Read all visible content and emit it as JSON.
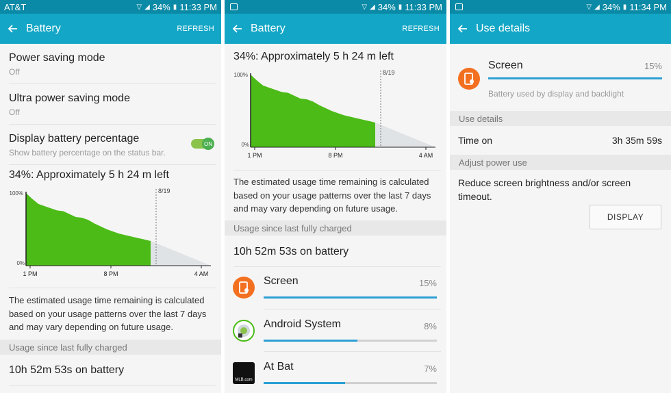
{
  "panels": [
    {
      "status": {
        "carrier": "AT&T",
        "battery": "34%",
        "time": "11:33 PM"
      },
      "appbar": {
        "title": "Battery",
        "action": "REFRESH"
      },
      "settings": [
        {
          "title": "Power saving mode",
          "sub": "Off"
        },
        {
          "title": "Ultra power saving mode",
          "sub": "Off"
        },
        {
          "title": "Display battery percentage",
          "sub": "Show battery percentage on the status bar.",
          "toggle": "ON"
        }
      ],
      "estimate": "34%: Approximately 5 h 24 m left",
      "description": "The estimated usage time remaining is calculated based on your usage patterns over the last 7 days and may vary depending on future usage.",
      "section_header": "Usage since last fully charged",
      "on_battery": "10h 52m 53s on battery"
    },
    {
      "status": {
        "battery": "34%",
        "time": "11:33 PM"
      },
      "appbar": {
        "title": "Battery",
        "action": "REFRESH"
      },
      "estimate": "34%: Approximately 5 h 24 m left",
      "description": "The estimated usage time remaining is calculated based on your usage patterns over the last 7 days and may vary depending on future usage.",
      "section_header": "Usage since last fully charged",
      "on_battery": "10h 52m 53s on battery",
      "apps": [
        {
          "name": "Screen",
          "percent": "15%",
          "fraction": 1.0,
          "icon": "screen-icon"
        },
        {
          "name": "Android System",
          "percent": "8%",
          "fraction": 0.54,
          "icon": "android-system-icon"
        },
        {
          "name": "At Bat",
          "percent": "7%",
          "fraction": 0.47,
          "icon": "at-bat-icon",
          "icon_text": "MLB.com"
        }
      ]
    },
    {
      "status": {
        "battery": "34%",
        "time": "11:34 PM"
      },
      "appbar": {
        "title": "Use details"
      },
      "app": {
        "name": "Screen",
        "percent": "15%",
        "desc": "Battery used by display and backlight"
      },
      "use_details_header": "Use details",
      "time_on_label": "Time on",
      "time_on_value": "3h 35m 59s",
      "adjust_header": "Adjust power use",
      "adjust_text": "Reduce screen brightness and/or screen timeout.",
      "display_button": "DISPLAY"
    }
  ],
  "chart_data": {
    "type": "area",
    "x_tick_labels": [
      "1 PM",
      "8 PM",
      "4 AM"
    ],
    "y_tick_labels": [
      "100%",
      "0%"
    ],
    "marker_label": "8/19",
    "ylim": [
      0,
      100
    ],
    "series": [
      {
        "values": [
          100,
          92,
          85,
          82,
          79,
          76,
          75,
          71,
          67,
          66,
          63,
          58,
          54,
          50,
          47,
          44,
          42,
          40,
          38,
          36,
          34
        ]
      },
      {
        "values": [
          34,
          0
        ]
      }
    ]
  },
  "colors": {
    "statusbar": "#0a8aa6",
    "appbar": "#13a6c6",
    "chart_fill": "#4cbb17",
    "projection_fill": "#dfe3e5",
    "progress": "#2b9fd4",
    "screen_icon": "#f37021"
  }
}
